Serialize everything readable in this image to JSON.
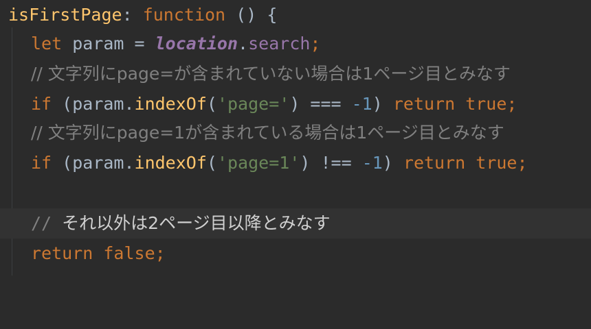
{
  "editor": {
    "lines": [
      {
        "tokens": [
          "isFirstPage",
          ": ",
          "function",
          " () {"
        ]
      },
      {
        "tokens": [
          "let",
          " param = ",
          "location",
          ".",
          "search",
          ";"
        ]
      },
      {
        "tokens": [
          "// 文字列にpage=が含まれていない場合は1ページ目とみなす"
        ]
      },
      {
        "tokens": [
          "if",
          " (param.",
          "indexOf",
          "(",
          "'page='",
          ") === ",
          "-1",
          ") ",
          "return true",
          ";"
        ]
      },
      {
        "tokens": [
          "// 文字列にpage=1が含まれている場合は1ページ目とみなす"
        ]
      },
      {
        "tokens": [
          "if",
          " (param.",
          "indexOf",
          "(",
          "'page=1'",
          ") !== ",
          "-1",
          ") ",
          "return true",
          ";"
        ]
      },
      {
        "tokens": [
          ""
        ]
      },
      {
        "tokens": [
          "//",
          " ",
          "それ以外は2ページ目以降とみなす"
        ]
      },
      {
        "tokens": [
          "return false",
          ";"
        ]
      }
    ]
  },
  "colors": {
    "background": "#2b2b2b",
    "current_line": "#323232",
    "keyword": "#cc7832",
    "function": "#ffc66d",
    "global": "#9876aa",
    "string": "#6a8759",
    "number": "#6897bb",
    "comment": "#808080",
    "text": "#a9b7c6"
  }
}
